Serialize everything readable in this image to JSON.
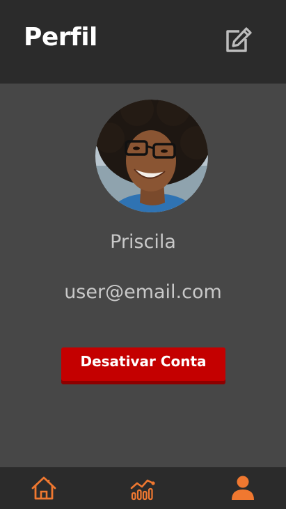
{
  "header": {
    "title": "Perfil",
    "edit_icon": "edit-square-icon"
  },
  "profile": {
    "avatar": "profile-photo",
    "name": "Priscila",
    "email": "user@email.com"
  },
  "actions": {
    "deactivate_label": "Desativar Conta"
  },
  "nav": {
    "items": [
      {
        "icon": "home-icon",
        "active": false
      },
      {
        "icon": "chart-icon",
        "active": false
      },
      {
        "icon": "user-icon",
        "active": true
      }
    ]
  },
  "colors": {
    "background": "#474747",
    "header": "#2b2b2b",
    "accent": "#f07830",
    "danger": "#c40000",
    "text_muted": "#c9c9c9"
  }
}
